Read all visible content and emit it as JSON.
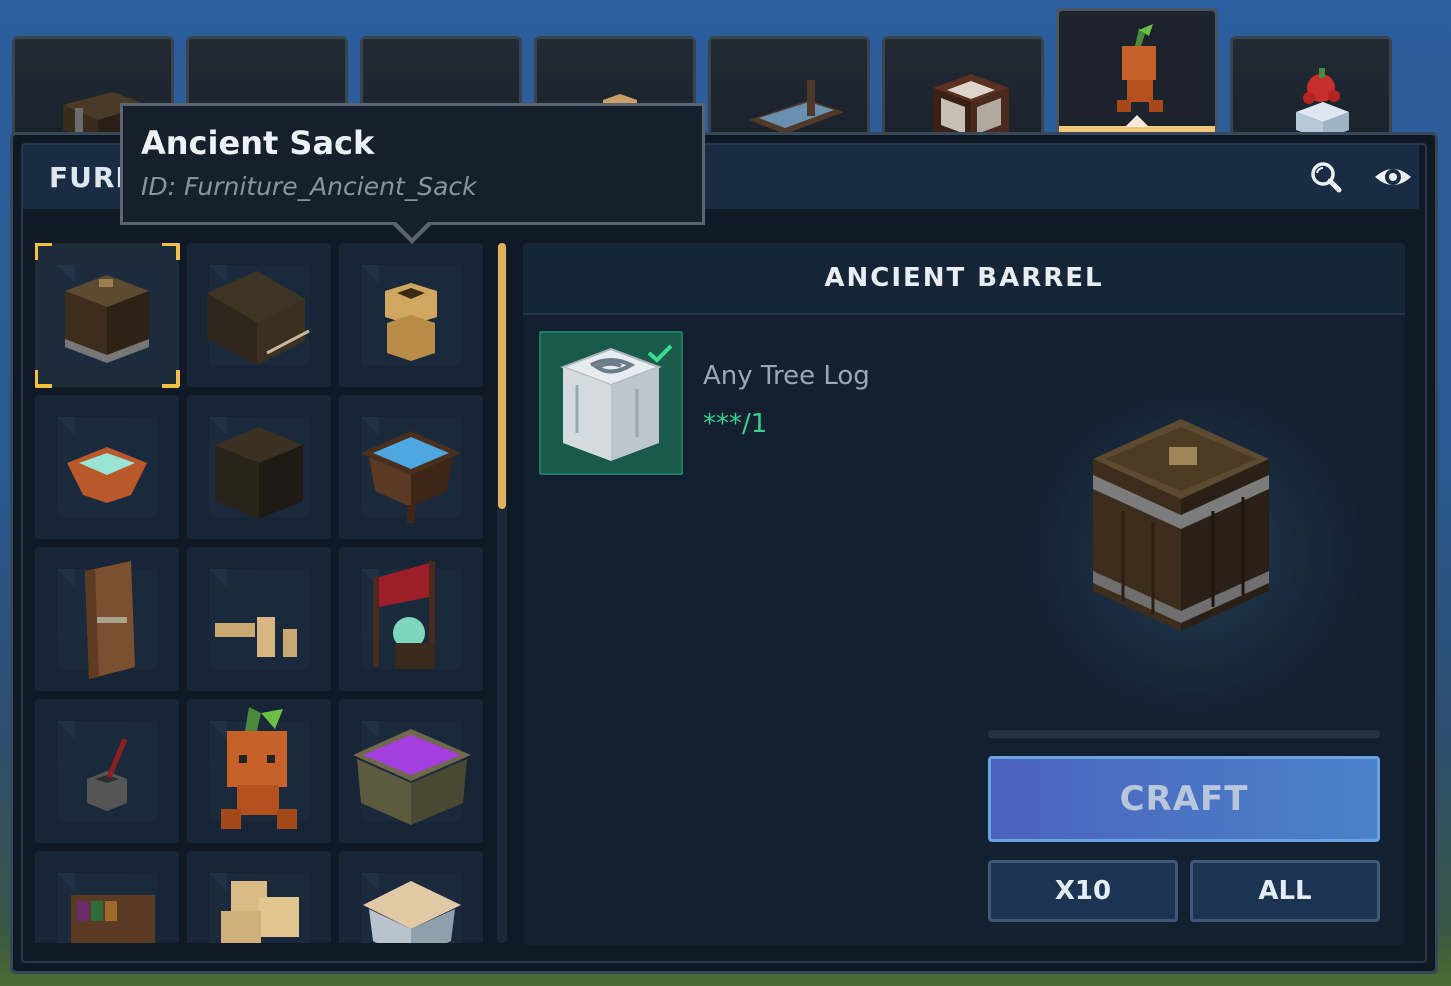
{
  "tabs": [
    {
      "icon": "chest-icon",
      "active": false
    },
    {
      "icon": "rug-icon",
      "active": false
    },
    {
      "icon": "table-icon",
      "active": false
    },
    {
      "icon": "pot-icon",
      "active": false
    },
    {
      "icon": "bed-icon",
      "active": false
    },
    {
      "icon": "frame-block-icon",
      "active": false
    },
    {
      "icon": "sprout-creature-icon",
      "active": true
    },
    {
      "icon": "festive-snowman-icon",
      "active": false
    }
  ],
  "header": {
    "title": "FURI",
    "search_icon": "search-icon",
    "view_icon": "eye-icon"
  },
  "tooltip": {
    "title": "Ancient Sack",
    "id_text": "ID: Furniture_Ancient_Sack"
  },
  "grid": {
    "items": [
      {
        "icon": "ancient-barrel-icon",
        "selected": true
      },
      {
        "icon": "broken-crate-icon"
      },
      {
        "icon": "ancient-sack-icon"
      },
      {
        "icon": "crystal-bowl-icon"
      },
      {
        "icon": "wooden-crate-icon"
      },
      {
        "icon": "water-trough-icon"
      },
      {
        "icon": "wooden-door-icon"
      },
      {
        "icon": "bone-pile-icon"
      },
      {
        "icon": "banner-shrine-icon"
      },
      {
        "icon": "quill-inkwell-icon"
      },
      {
        "icon": "sprout-figure-icon"
      },
      {
        "icon": "purple-cauldron-icon"
      },
      {
        "icon": "bookshelf-icon"
      },
      {
        "icon": "skull-pile-icon"
      },
      {
        "icon": "straw-hut-icon"
      }
    ],
    "scroll_fraction": 0.38
  },
  "detail": {
    "title": "ANCIENT BARREL",
    "ingredients": [
      {
        "icon": "tree-log-icon",
        "name": "Any Tree Log",
        "count": "***/1",
        "satisfied": true
      }
    ],
    "preview_icon": "ancient-barrel-preview",
    "craft_label": "CRAFT",
    "x10_label": "X10",
    "all_label": "ALL"
  },
  "colors": {
    "accent_gold": "#f2c23f",
    "craft_blue": "#4c63bd",
    "ingredient_green": "#2ed28a",
    "panel_bg": "#0f1923"
  }
}
